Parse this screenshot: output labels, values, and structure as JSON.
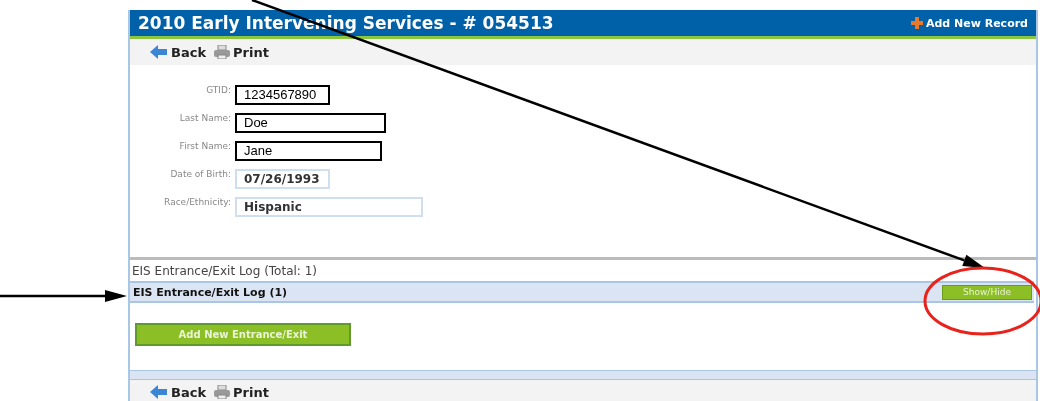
{
  "header": {
    "title": "2010 Early Intervening Services - # 054513",
    "action": "Add New Record"
  },
  "toolbar": {
    "back": "Back",
    "print": "Print"
  },
  "fields": [
    {
      "label": "GTID:",
      "value": "1234567890",
      "kind": "outlined"
    },
    {
      "label": "Last Name:",
      "value": "Doe",
      "kind": "outlined"
    },
    {
      "label": "First Name:",
      "value": "Jane",
      "kind": "outlined"
    },
    {
      "label": "Date of Birth:",
      "value": "07/26/1993",
      "kind": "plain"
    },
    {
      "label": "Race/Ethnicity:",
      "value": "Hispanic",
      "kind": "plain"
    }
  ],
  "log_total": "EIS Entrance/Exit Log (Total: 1)",
  "log_section": {
    "title": "EIS Entrance/Exit Log (1)",
    "toggle": "Show/Hide"
  },
  "add_button": "Add New Entrance/Exit",
  "footer_toolbar": {
    "back": "Back",
    "print": "Print"
  },
  "annotations": [
    {
      "kind": "arrow"
    },
    {
      "kind": "arrow"
    },
    {
      "kind": "ellipse"
    }
  ]
}
